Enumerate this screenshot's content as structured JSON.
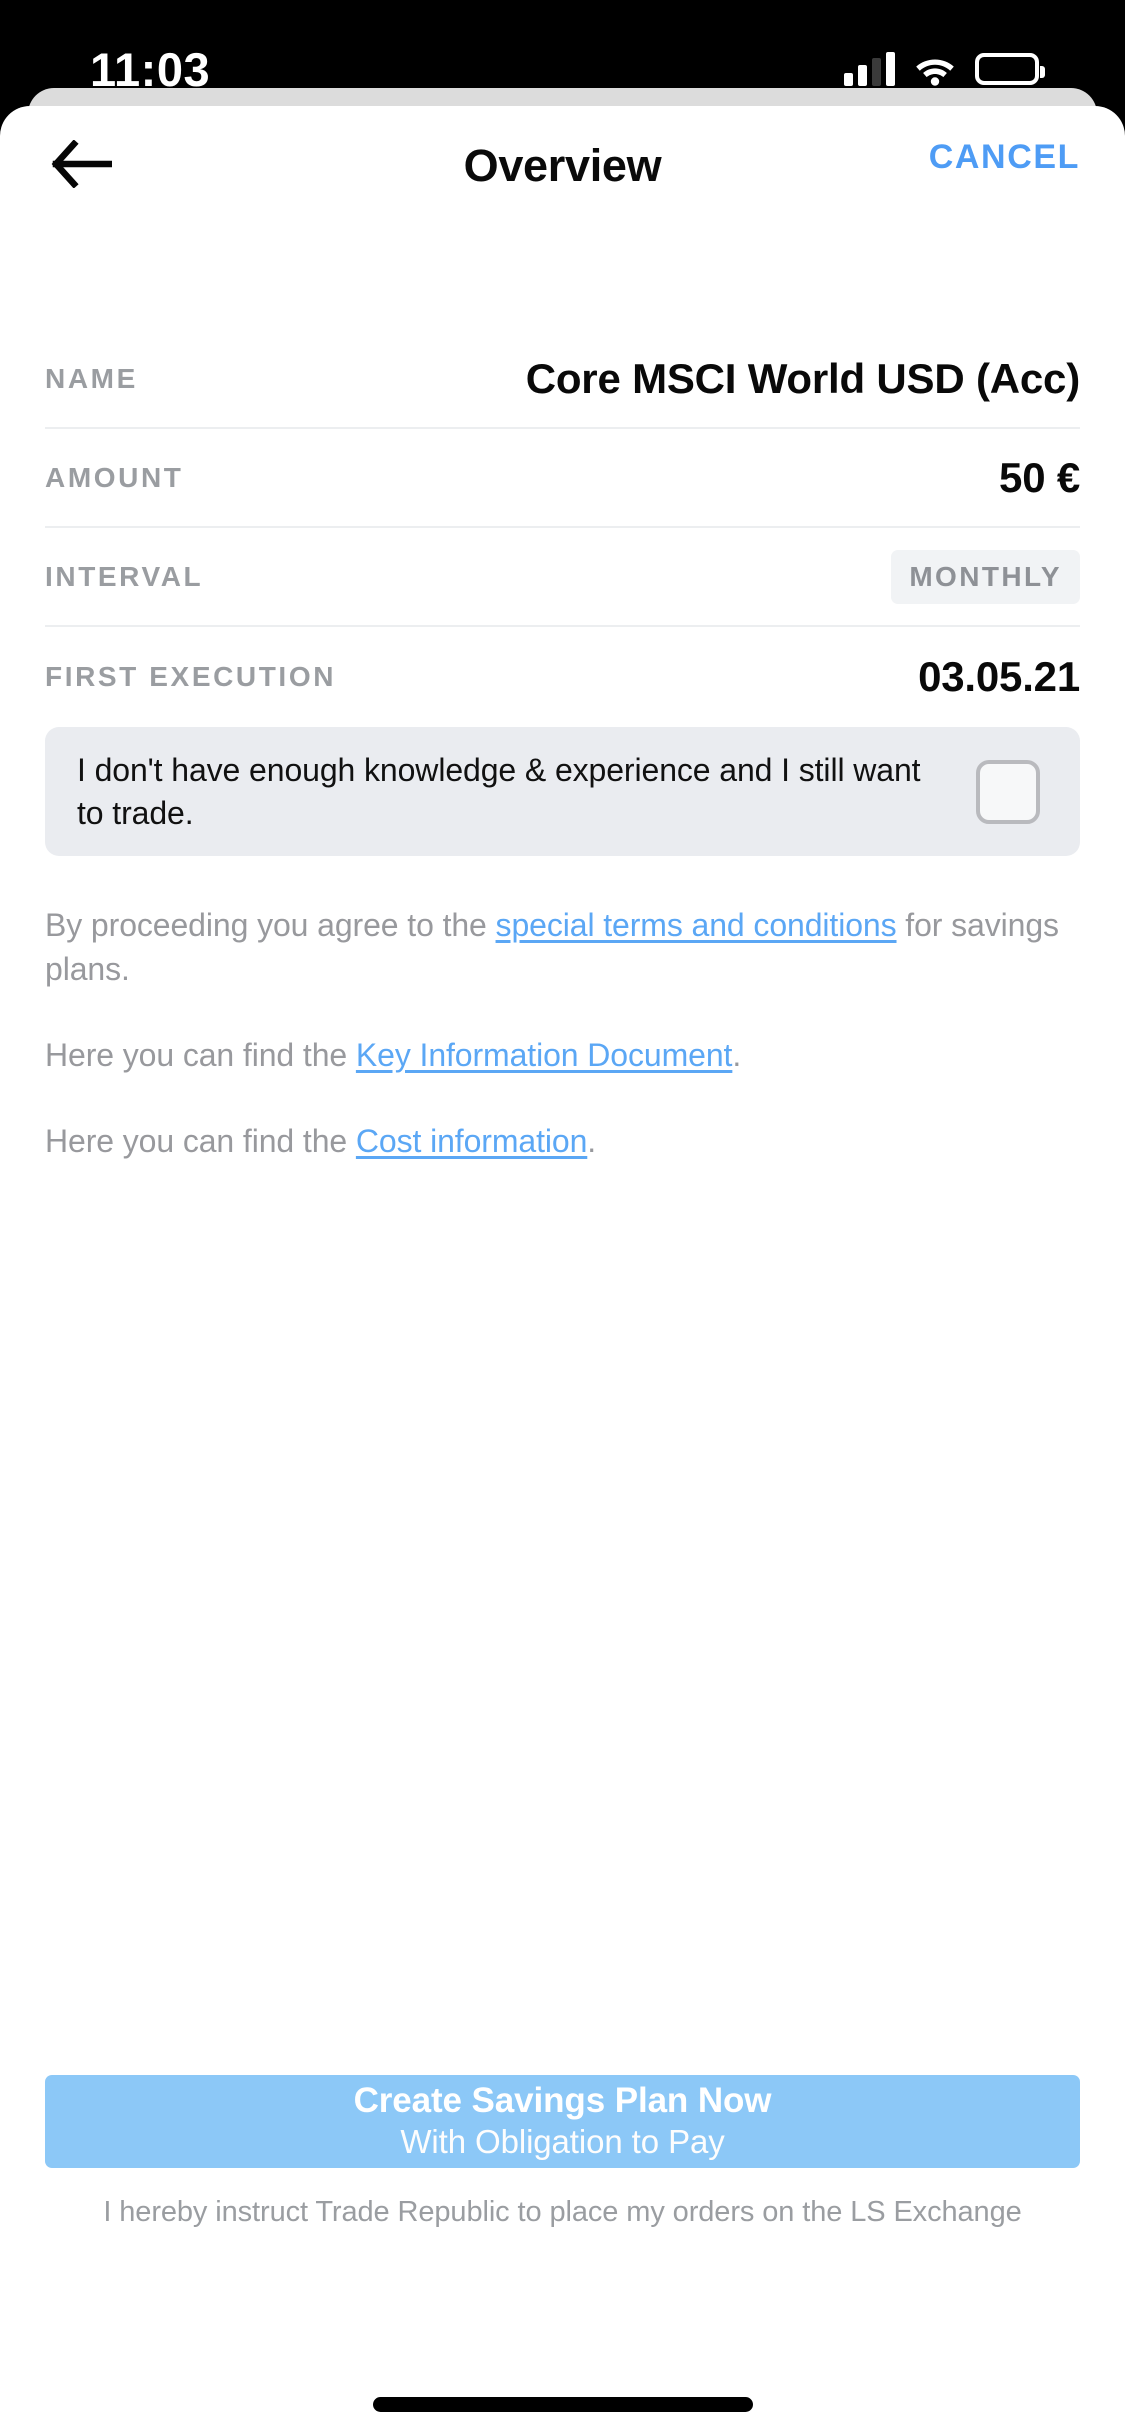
{
  "status_bar": {
    "time": "11:03",
    "signal_icon": "cellular-signal-icon",
    "wifi_icon": "wifi-icon",
    "battery_icon": "battery-icon"
  },
  "header": {
    "back_icon": "arrow-left-icon",
    "title": "Overview",
    "cancel_label": "CANCEL"
  },
  "details": {
    "rows": [
      {
        "label": "NAME",
        "value": "Core MSCI World USD (Acc)",
        "style": "text"
      },
      {
        "label": "AMOUNT",
        "value": "50 €",
        "style": "text"
      },
      {
        "label": "INTERVAL",
        "value": "MONTHLY",
        "style": "badge"
      },
      {
        "label": "FIRST EXECUTION",
        "value": "03.05.21",
        "style": "text"
      }
    ]
  },
  "consent": {
    "text": "I don't have enough knowledge & experience and I still want to trade.",
    "checked": false
  },
  "legal": {
    "terms_prefix": "By proceeding you agree to the ",
    "terms_link": "special terms and conditions",
    "terms_suffix": " for savings plans.",
    "kid_prefix": "Here you can find the ",
    "kid_link": "Key Information Document",
    "kid_suffix": ".",
    "cost_prefix": "Here you can find the ",
    "cost_link": "Cost information",
    "cost_suffix": "."
  },
  "cta": {
    "main_label": "Create Savings Plan Now",
    "sub_label": "With Obligation to Pay",
    "disclaimer": "I hereby instruct Trade Republic to place my orders on the LS Exchange"
  },
  "colors": {
    "accent_blue": "#4E9CF5",
    "link_blue": "#5BA7F5",
    "cta_blue": "#8CC8F7",
    "muted_gray": "#9a9da1",
    "consent_bg": "#eaecf0",
    "badge_bg": "#f1f3f5"
  }
}
